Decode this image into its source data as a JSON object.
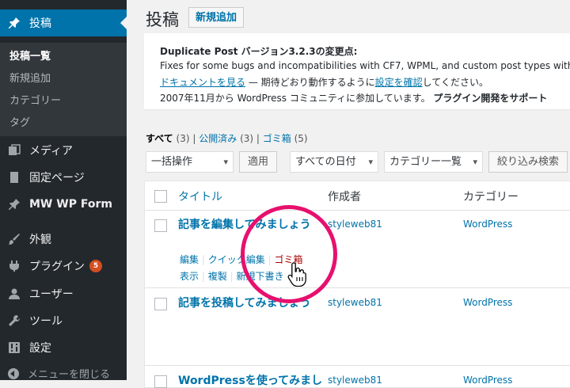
{
  "sidebar": {
    "items": [
      {
        "label": "投稿",
        "icon": "pin-icon",
        "active": true
      },
      {
        "label": "メディア",
        "icon": "media-icon"
      },
      {
        "label": "固定ページ",
        "icon": "page-icon"
      },
      {
        "label": "MW WP Form",
        "icon": "pin-icon"
      },
      {
        "label": "外観",
        "icon": "brush-icon"
      },
      {
        "label": "プラグイン",
        "icon": "plugin-icon",
        "badge": "5"
      },
      {
        "label": "ユーザー",
        "icon": "user-icon"
      },
      {
        "label": "ツール",
        "icon": "wrench-icon"
      },
      {
        "label": "設定",
        "icon": "settings-icon"
      }
    ],
    "submenu": [
      "投稿一覧",
      "新規追加",
      "カテゴリー",
      "タグ"
    ],
    "collapse_label": "メニューを閉じる"
  },
  "header": {
    "title": "投稿",
    "add_new": "新規追加"
  },
  "notice": {
    "line1": "Duplicate Post バージョン3.2.3の変更点:",
    "line2": "Fixes for some bugs and incompatibilities with CF7, WPML, and custom post types with cus",
    "line3_link1": "ドキュメントを見る",
    "line3_mid": " — 期待どおり動作するように",
    "line3_link2": "設定を確認",
    "line3_end": "してください。",
    "line4_text": "2007年11月から WordPress コミュニティに参加しています。",
    "line4_bold": "プラグイン開発をサポート"
  },
  "views": {
    "all": "すべて",
    "all_count": "(3)",
    "published": "公開済み",
    "published_count": "(3)",
    "trash": "ゴミ箱",
    "trash_count": "(5)",
    "sep": "|"
  },
  "filters": {
    "bulk_action": "一括操作",
    "apply": "適用",
    "dates": "すべての日付",
    "category": "カテゴリー一覧",
    "filter": "絞り込み検索"
  },
  "table": {
    "columns": [
      "タイトル",
      "作成者",
      "カテゴリー"
    ],
    "rows": [
      {
        "title": "記事を編集してみましょう",
        "author": "styleweb81",
        "category": "WordPress"
      },
      {
        "title": "記事を投稿してみましょう",
        "author": "styleweb81",
        "category": "WordPress"
      },
      {
        "title": "WordPressを使ってみまし",
        "author": "styleweb81",
        "category": "WordPress"
      }
    ],
    "row_actions": {
      "edit": "編集",
      "quick_edit": "クイック編集",
      "trash": "ゴミ箱",
      "view": "表示",
      "clone": "複製",
      "new_draft": "新規下書き",
      "sep": "|"
    }
  },
  "colors": {
    "accent": "#0073aa",
    "sidebar_bg": "#23282d",
    "highlight": "#e7106d",
    "trash": "#a00"
  }
}
